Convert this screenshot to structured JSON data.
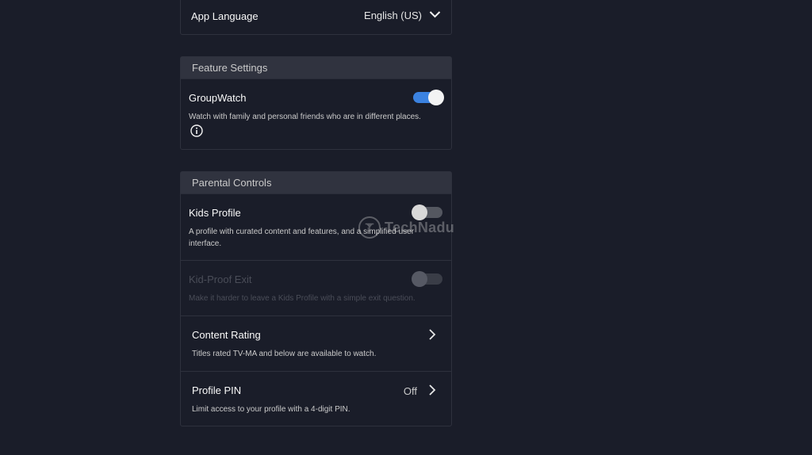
{
  "language_panel": {
    "label": "App Language",
    "value": "English (US)"
  },
  "feature_settings": {
    "header": "Feature Settings",
    "groupwatch": {
      "title": "GroupWatch",
      "description": "Watch with family and personal friends who are in different places.",
      "enabled": true,
      "info_icon": "info-icon"
    }
  },
  "parental_controls": {
    "header": "Parental Controls",
    "kids_profile": {
      "title": "Kids Profile",
      "description": "A profile with curated content and features, and a simplified user interface.",
      "enabled": false
    },
    "kid_proof_exit": {
      "title": "Kid-Proof Exit",
      "description": "Make it harder to leave a Kids Profile with a simple exit question.",
      "enabled": false,
      "disabled": true
    },
    "content_rating": {
      "title": "Content Rating",
      "description": "Titles rated TV-MA and below are available to watch."
    },
    "profile_pin": {
      "title": "Profile PIN",
      "value": "Off",
      "description": "Limit access to your profile with a 4-digit PIN."
    }
  },
  "watermark": {
    "text": "TechNadu"
  },
  "colors": {
    "background": "#1a1d29",
    "section_header": "#30333f",
    "toggle_on": "#3b82e0"
  }
}
